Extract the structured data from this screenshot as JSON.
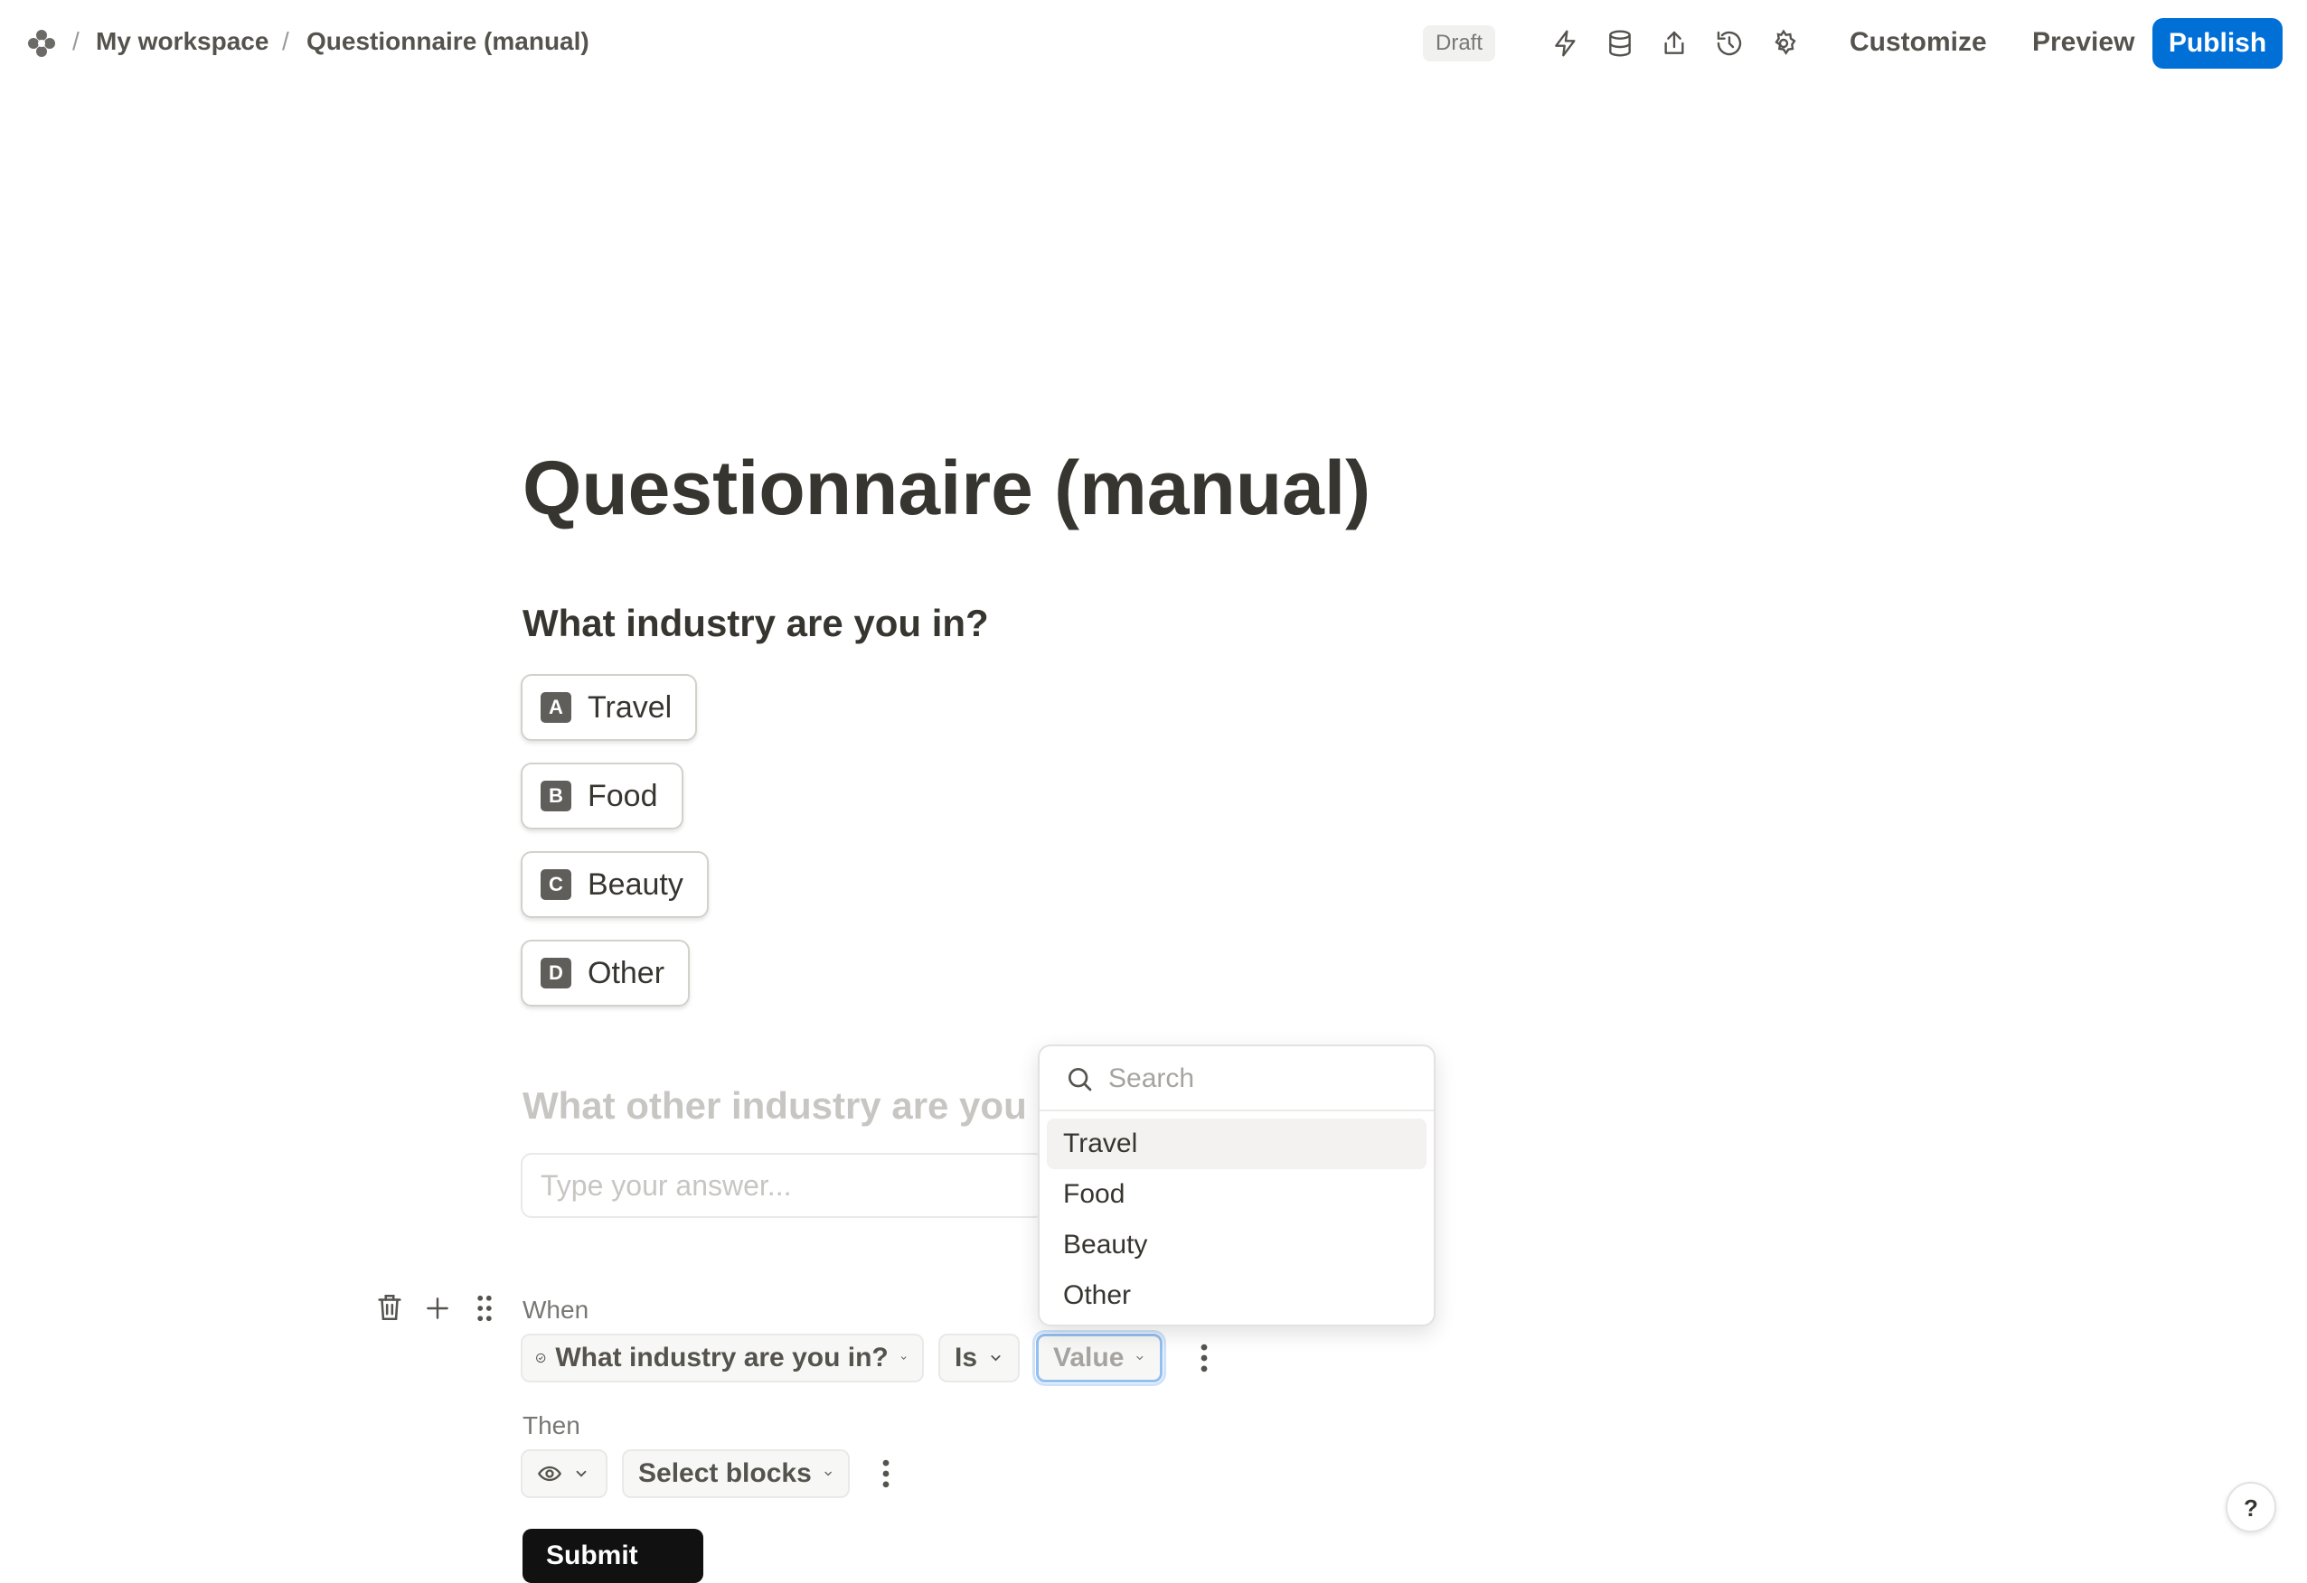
{
  "breadcrumb": {
    "workspace": "My workspace",
    "page": "Questionnaire (manual)",
    "separator": "/"
  },
  "toolbar": {
    "status": "Draft",
    "icons": [
      "lightning-icon",
      "database-icon",
      "share-icon",
      "history-icon",
      "settings-icon"
    ],
    "customize_label": "Customize",
    "preview_label": "Preview",
    "publish_label": "Publish",
    "publish_color": "#0070d7"
  },
  "form": {
    "title": "Questionnaire (manual)",
    "question1": {
      "text": "What industry are you in?",
      "choices": [
        {
          "key": "A",
          "label": "Travel"
        },
        {
          "key": "B",
          "label": "Food"
        },
        {
          "key": "C",
          "label": "Beauty"
        },
        {
          "key": "D",
          "label": "Other"
        }
      ]
    },
    "question2": {
      "text": "What other industry are you in?",
      "placeholder": "Type your answer..."
    },
    "submit_label": "Submit"
  },
  "logic": {
    "when_label": "When",
    "field": "What industry are you in?",
    "operator": "Is",
    "value_placeholder": "Value",
    "then_label": "Then",
    "then_action_icon": "eye-icon",
    "select_blocks_label": "Select blocks"
  },
  "dropdown": {
    "search_placeholder": "Search",
    "options": [
      "Travel",
      "Food",
      "Beauty",
      "Other"
    ],
    "highlighted": "Travel"
  },
  "help_label": "?"
}
